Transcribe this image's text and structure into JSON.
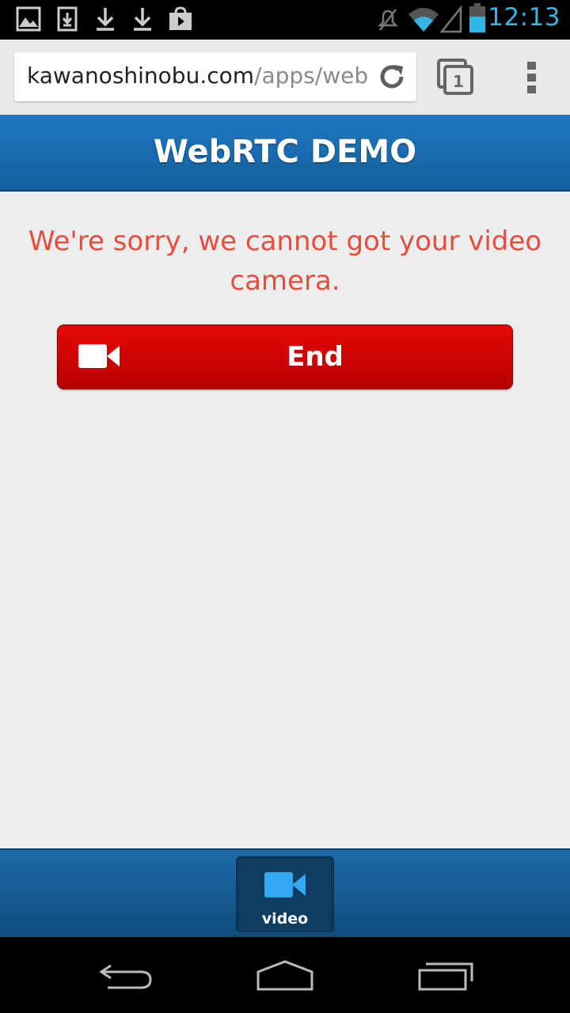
{
  "status_bar": {
    "time": "12:13",
    "notification_icons": [
      "image-icon",
      "download-box-icon",
      "download-icon",
      "download-icon",
      "play-store-icon"
    ],
    "system_icons": [
      "muted-icon",
      "wifi-icon",
      "signal-icon",
      "battery-icon"
    ],
    "time_color": "#33b5e5"
  },
  "browser": {
    "url_host": "kawanoshinobu.com",
    "url_path": "/apps/web",
    "tab_count": "1"
  },
  "page": {
    "header_title": "WebRTC DEMO",
    "error_message": "We're sorry, we cannot got your video camera.",
    "error_color": "#e74c3c",
    "end_button_label": "End",
    "end_button_color": "#d80000"
  },
  "footer": {
    "nav_item_label": "video",
    "nav_icon_color": "#33a8f0"
  },
  "system_nav": [
    "back-icon",
    "home-icon",
    "recents-icon"
  ]
}
